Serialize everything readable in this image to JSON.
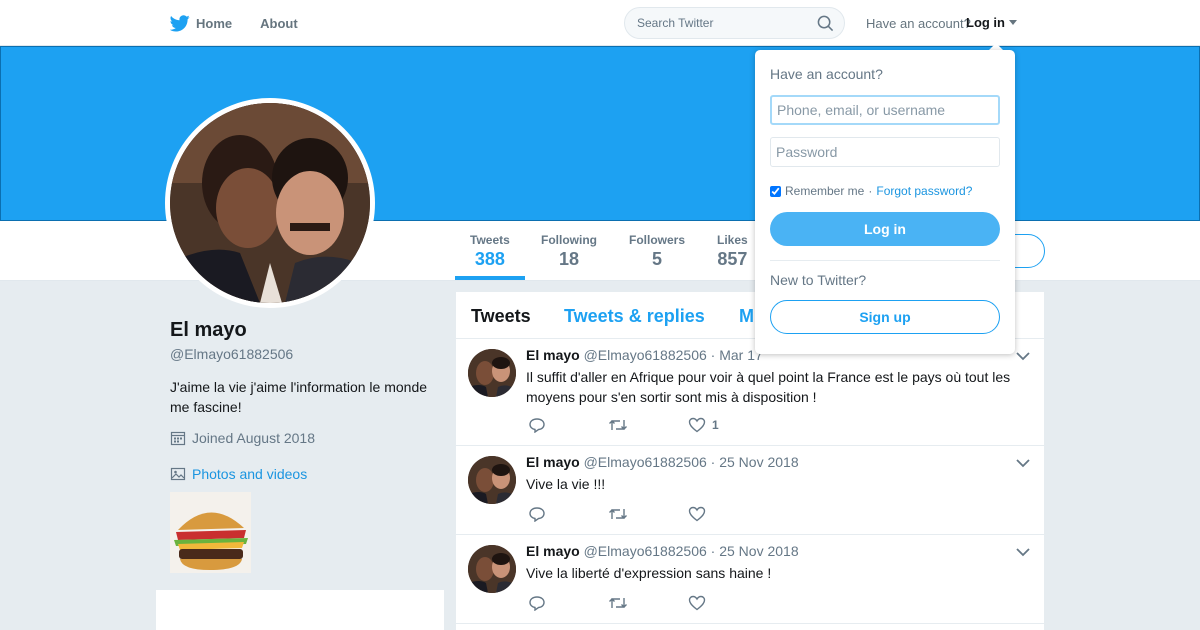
{
  "nav": {
    "home_label": "Home",
    "about_label": "About",
    "search_placeholder": "Search Twitter",
    "account_prompt": "Have an account?",
    "login_label": "Log in"
  },
  "profile": {
    "name": "El mayo",
    "handle": "@Elmayo61882506",
    "bio": "J'aime la vie j'aime l'information le monde me fascine!",
    "joined": "Joined August 2018",
    "photos_label": "Photos and videos"
  },
  "stats": [
    {
      "label": "Tweets",
      "value": "388"
    },
    {
      "label": "Following",
      "value": "18"
    },
    {
      "label": "Followers",
      "value": "5"
    },
    {
      "label": "Likes",
      "value": "857"
    }
  ],
  "timeline": {
    "tabs": [
      "Tweets",
      "Tweets & replies",
      "M"
    ],
    "tweets": [
      {
        "name": "El mayo",
        "handle": "@Elmayo61882506",
        "date": "· Mar 17",
        "text": "Il suffit d'aller en Afrique pour voir à quel point la France est le pays où tout les moyens pour s'en sortir sont mis à disposition !",
        "likes": "1"
      },
      {
        "name": "El mayo",
        "handle": "@Elmayo61882506",
        "date": "· 25 Nov 2018",
        "text": "Vive la vie !!!",
        "likes": ""
      },
      {
        "name": "El mayo",
        "handle": "@Elmayo61882506",
        "date": "· 25 Nov 2018",
        "text": "Vive la liberté d'expression sans haine !",
        "likes": ""
      }
    ]
  },
  "login_dropdown": {
    "heading": "Have an account?",
    "username_placeholder": "Phone, email, or username",
    "password_placeholder": "Password",
    "remember_label": "Remember me",
    "separator": "·",
    "forgot_label": "Forgot password?",
    "login_button": "Log in",
    "new_prompt": "New to Twitter?",
    "signup_button": "Sign up"
  },
  "colors": {
    "brand_blue": "#1da1f2",
    "link_blue": "#1b95e0",
    "login_button_blue": "#4ab3f4"
  },
  "icons": [
    "twitter-bird-icon",
    "home-icon",
    "search-icon",
    "calendar-icon",
    "photo-icon",
    "reply-icon",
    "retweet-icon",
    "heart-icon",
    "chevron-down-icon"
  ]
}
